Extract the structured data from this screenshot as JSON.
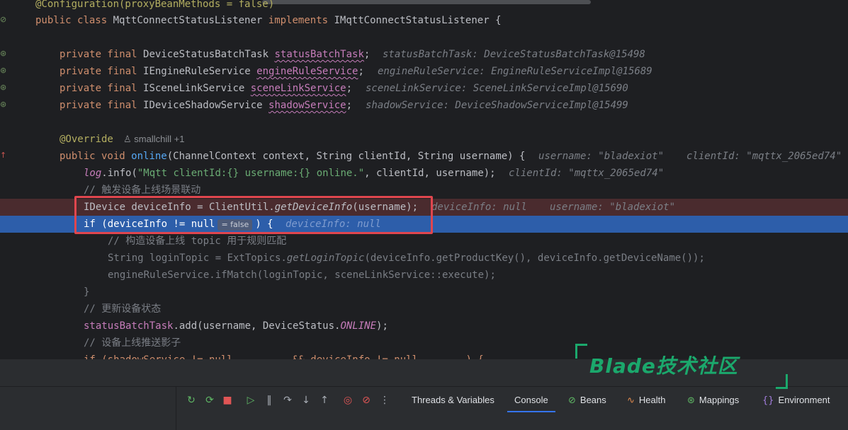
{
  "editor": {
    "lines": {
      "annot_cut": "@Configuration(proxyBeanMethods = false)",
      "class_decl": [
        "public",
        "class",
        "MqttConnectStatusListener",
        "implements",
        "IMqttConnectStatusListener {"
      ],
      "fields": [
        {
          "type": "DeviceStatusBatchTask",
          "name": "statusBatchTask",
          "hint": "statusBatchTask: DeviceStatusBatchTask@15498"
        },
        {
          "type": "IEngineRuleService",
          "name": "engineRuleService",
          "hint": "engineRuleService: EngineRuleServiceImpl@15689"
        },
        {
          "type": "ISceneLinkService",
          "name": "sceneLinkService",
          "hint": "sceneLinkService: SceneLinkServiceImpl@15690"
        },
        {
          "type": "IDeviceShadowService",
          "name": "shadowService",
          "hint": "shadowService: DeviceShadowServiceImpl@15499"
        }
      ],
      "field_modifiers": "private final",
      "override": "@Override",
      "author": "smallchill +1",
      "method_sig": {
        "mods": "public void",
        "name": "online",
        "params": "(ChannelContext context, String clientId, String username) {",
        "hint1": "username: \"bladexiot\"",
        "hint2": "clientId: \"mqttx_2065ed74\""
      },
      "log_line": {
        "obj": "log",
        "call": ".info(",
        "str": "\"Mqtt clientId:{} username:{} online.\"",
        "rest": ", clientId, username);",
        "hint": "clientId: \"mqttx_2065ed74\""
      },
      "comment1": "// 触发设备上线场景联动",
      "device_line": {
        "pre": "IDevice deviceInfo = ClientUtil.",
        "call": "getDeviceInfo",
        "rest": "(username);",
        "hint1": "deviceInfo: null",
        "hint2": "username: \"bladexiot\""
      },
      "if_line": {
        "pre": "if (deviceInfo != ",
        "null": "null",
        "chip": "= false",
        "rest": ") {",
        "hint": "deviceInfo: null"
      },
      "comment2": "// 构造设备上线 topic 用于规则匹配",
      "login_line": {
        "pre": "String loginTopic = ExtTopics.",
        "call": "getLoginTopic",
        "rest": "(deviceInfo.getProductKey(), deviceInfo.getDeviceName());"
      },
      "match_line": "engineRuleService.ifMatch(loginTopic, sceneLinkService::execute);",
      "close_brace": "}",
      "comment3": "// 更新设备状态",
      "status_line": {
        "obj": "statusBatchTask",
        "rest": ".add(username, DeviceStatus.",
        "const": "ONLINE",
        "end": ");"
      },
      "comment4": "// 设备上线推送影子",
      "last_cut": "if (shadowService != null          && deviceInfo != null        ) {"
    }
  },
  "watermark": {
    "text": "Blade技术社区"
  },
  "toolbar": {
    "icons": [
      "rerun-icon",
      "restart-icon",
      "stop-icon",
      "resume-icon",
      "pause-icon",
      "step-over-icon",
      "step-into-icon",
      "step-out-icon",
      "view-breakpoints-icon",
      "mute-breakpoints-icon",
      "more-icon"
    ],
    "tabs": [
      {
        "label": "Threads & Variables",
        "icon": ""
      },
      {
        "label": "Console",
        "icon": ""
      },
      {
        "label": "Beans",
        "icon": "beans-icon"
      },
      {
        "label": "Health",
        "icon": "health-icon"
      },
      {
        "label": "Mappings",
        "icon": "mappings-icon"
      },
      {
        "label": "Environment",
        "icon": "environment-icon"
      }
    ],
    "active_tab": "Console"
  },
  "colors": {
    "exec_line": "#2d5eaa",
    "breakpoint_line": "#4a2b2e",
    "highlight_box": "#e0464e",
    "watermark": "#1ba86c"
  }
}
